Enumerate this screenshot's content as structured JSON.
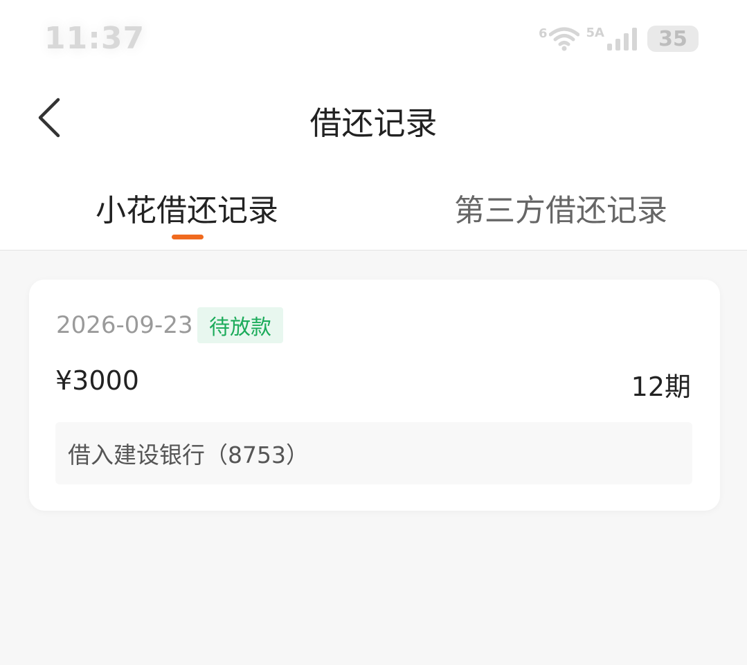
{
  "status_bar": {
    "time": "11:37",
    "wifi_label": "6",
    "network_label": "5A",
    "battery": "35"
  },
  "nav": {
    "title": "借还记录"
  },
  "tabs": [
    {
      "label": "小花借还记录",
      "active": true
    },
    {
      "label": "第三方借还记录",
      "active": false
    }
  ],
  "record": {
    "date": "2026-09-23",
    "status": "待放款",
    "amount": "¥3000",
    "periods": "12期",
    "bank": "借入建设银行（8753）"
  },
  "colors": {
    "accent": "#f06a1e",
    "status_green": "#1bab5a",
    "status_bg": "#e8f7ef",
    "page_bg": "#f7f7f7"
  }
}
